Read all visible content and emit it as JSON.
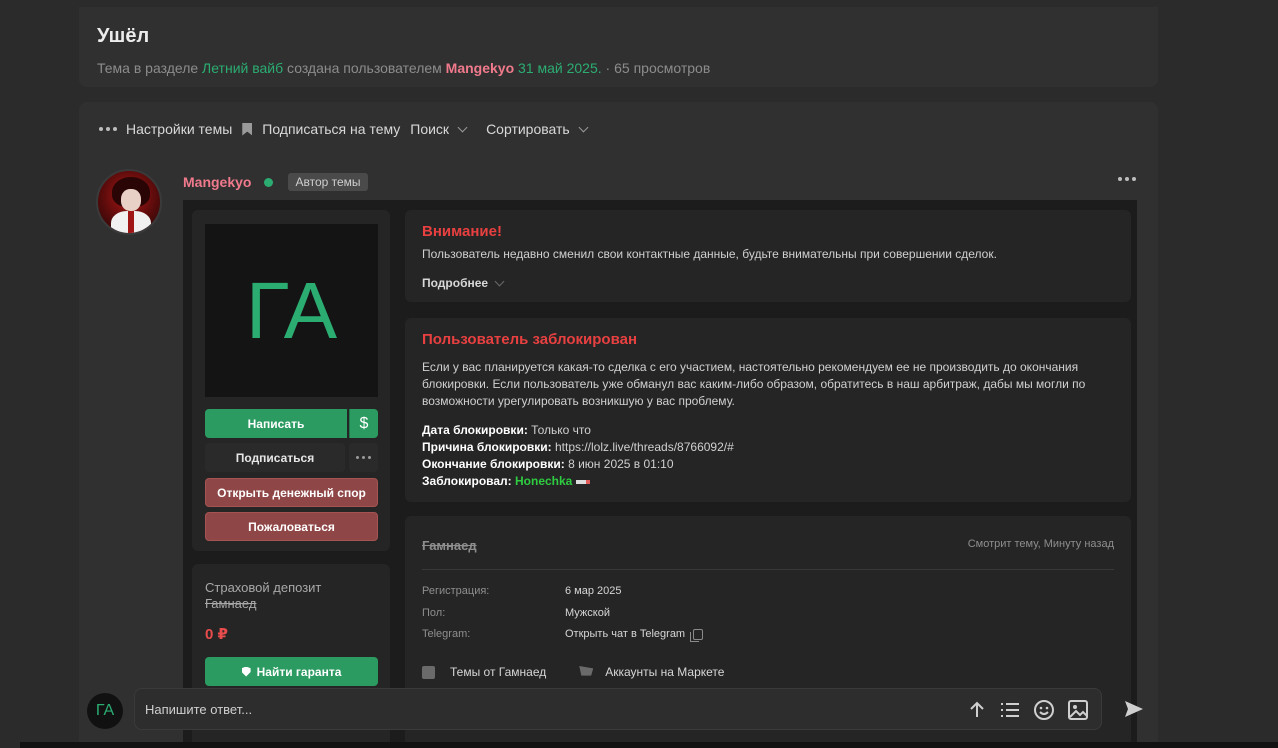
{
  "thread": {
    "title": "Ушёл",
    "meta_prefix": "Тема в разделе",
    "section": "Летний вайб",
    "meta_created": "создана пользователем",
    "author": "Mangekyo",
    "date": "31 май 2025.",
    "views": "65 просмотров"
  },
  "toolbar": {
    "settings": "Настройки темы",
    "subscribe": "Подписаться на тему",
    "search": "Поиск",
    "sort": "Сортировать"
  },
  "post": {
    "author": "Mangekyo",
    "author_badge": "Автор темы"
  },
  "profile_card": {
    "avatar_text": "ГА",
    "write_label": "Написать",
    "money_label": "$",
    "subscribe_label": "Подписаться",
    "dispute_label": "Открыть денежный спор",
    "report_label": "Пожаловаться",
    "deposit_title": "Страховой депозит",
    "deposit_name": "Гамнаед",
    "deposit_amount": "0 ₽",
    "guarant_label": "Найти гаранта"
  },
  "warning": {
    "title": "Внимание!",
    "text": "Пользователь недавно сменил свои контактные данные, будьте внимательны при совершении сделок.",
    "more_label": "Подробнее"
  },
  "ban": {
    "title": "Пользователь заблокирован",
    "text": "Если у вас планируется какая-то сделка с его участием, настоятельно рекомендуем ее не производить до окончания блокировки. Если пользователь уже обманул вас каким-либо образом, обратитесь в наш арбитраж, дабы мы могли по возможности урегулировать возникшую у вас проблему.",
    "date_label": "Дата блокировки:",
    "date_value": "Только что",
    "reason_label": "Причина блокировки:",
    "reason_value": "https://lolz.live/threads/8766092/#",
    "end_label": "Окончание блокировки:",
    "end_value": "8 июн 2025 в 01:10",
    "by_label": "Заблокировал:",
    "by_value": "Honechka"
  },
  "profile": {
    "name": "Гамнаед",
    "status": "Смотрит тему, Минуту назад",
    "reg_label": "Регистрация:",
    "reg_value": "6 мар 2025",
    "gender_label": "Пол:",
    "gender_value": "Мужской",
    "telegram_label": "Telegram:",
    "telegram_value": "Открыть чат в Telegram",
    "threads_link": "Темы от Гамнаед",
    "market_link": "Аккаунты на Маркете"
  },
  "reply": {
    "avatar_text": "ГА",
    "placeholder": "Напишите ответ..."
  },
  "colors": {
    "accent_green": "#2bad72",
    "username_pink": "#f07a8c",
    "danger_red": "#e84040"
  }
}
